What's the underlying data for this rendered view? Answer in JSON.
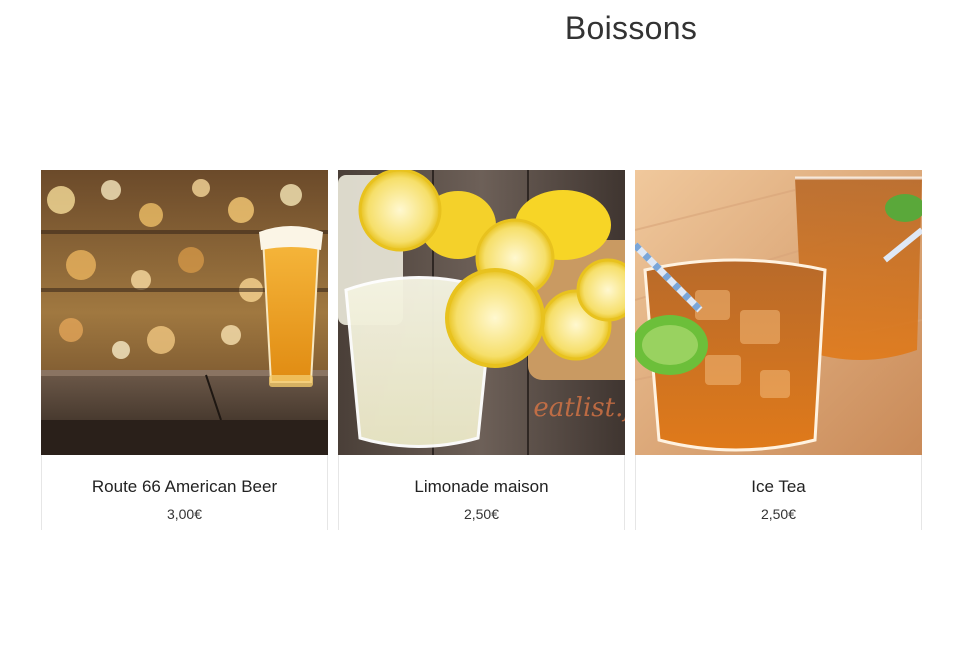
{
  "page": {
    "title": "Boissons"
  },
  "products": [
    {
      "name": "Route 66 American Beer",
      "price": "3,00€",
      "image": "beer-glass-on-bar"
    },
    {
      "name": "Limonade maison",
      "price": "2,50€",
      "image": "lemonade-with-lemons"
    },
    {
      "name": "Ice Tea",
      "price": "2,50€",
      "image": "iced-tea-glasses"
    }
  ],
  "watermark": "eatlist.f"
}
